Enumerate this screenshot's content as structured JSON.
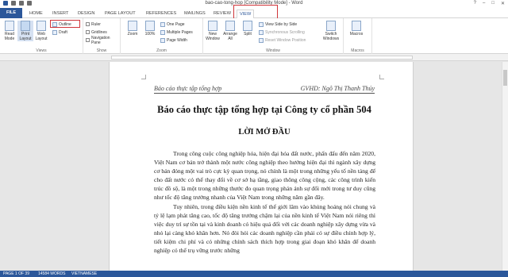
{
  "window": {
    "title": "bao-cao-tong-hop [Compatibility Mode] - Word",
    "controls": [
      "?",
      "–",
      "□",
      "✕"
    ]
  },
  "tabs": [
    "FILE",
    "HOME",
    "INSERT",
    "DESIGN",
    "PAGE LAYOUT",
    "REFERENCES",
    "MAILINGS",
    "REVIEW",
    "VIEW"
  ],
  "ribbon": {
    "views": {
      "label": "Views",
      "read_mode": "Read Mode",
      "print_layout": "Print Layout",
      "web_layout": "Web Layout",
      "outline": "Outline",
      "draft": "Draft"
    },
    "show": {
      "label": "Show",
      "ruler": "Ruler",
      "gridlines": "Gridlines",
      "navigation_pane": "Navigation Pane"
    },
    "zoom": {
      "label": "Zoom",
      "zoom": "Zoom",
      "percent": "100%",
      "one_page": "One Page",
      "multiple_pages": "Multiple Pages",
      "page_width": "Page Width"
    },
    "window": {
      "label": "Window",
      "new_window": "New Window",
      "arrange_all": "Arrange All",
      "split": "Split",
      "view_side_by_side": "View Side by Side",
      "sync_scrolling": "Synchronous Scrolling",
      "reset_position": "Reset Window Position",
      "switch_windows": "Switch Windows"
    },
    "macros": {
      "label": "Macros",
      "macros": "Macros"
    }
  },
  "document": {
    "header_left": "Báo cáo thực tập tổng hợp",
    "header_right": "GVHD: Ngô Thị Thanh Thúy",
    "title": "Báo cáo thực tập tổng hợp tại Công ty cổ phần 504",
    "heading": "LỜI MỞ ĐẦU",
    "paragraph1": "Trong công cuộc công nghiệp hóa, hiện đại hóa đất nước, phấn đấu đến năm 2020, Việt Nam cơ bản trở thành một nước công nghiệp theo hướng hiện đại thì ngành xây dựng cơ bản đóng một vai trò cực kỳ quan trọng, nó chính là một trong những yếu tố nền tảng để cho đất nước có thể thay đổi về cơ sở hạ tầng, giao thông công cộng, các công trình kiến trúc đồ sộ, là một trong những thước đo quan trọng phản ánh sự đổi mới trong tư duy cũng như tốc độ tăng trưởng nhanh của Việt Nam trong những năm gần đây.",
    "paragraph2": "Tuy nhiên, trong điều kiện nền kinh tế thế giới lâm vào khủng hoảng nói chung và tỷ lệ lạm phát tăng cao, tốc độ tăng trưởng chậm lại của nền kinh tế Việt Nam nói riêng thì việc duy trì sự tồn tại và kinh doanh có hiệu quả đối với các doanh nghiệp xây dựng vừa và nhỏ lại càng khó khăn hơn. Nó đòi hỏi các doanh nghiệp cần phải có sự điều chỉnh hợp lý, tiết kiệm chi phí và có những chính sách thích hợp trong giai đoạn khó khăn để doanh nghiệp có thể trụ vững trước những"
  },
  "status": {
    "page": "PAGE 1 OF 39",
    "words": "14584 WORDS",
    "language": "VIETNAMESE"
  }
}
